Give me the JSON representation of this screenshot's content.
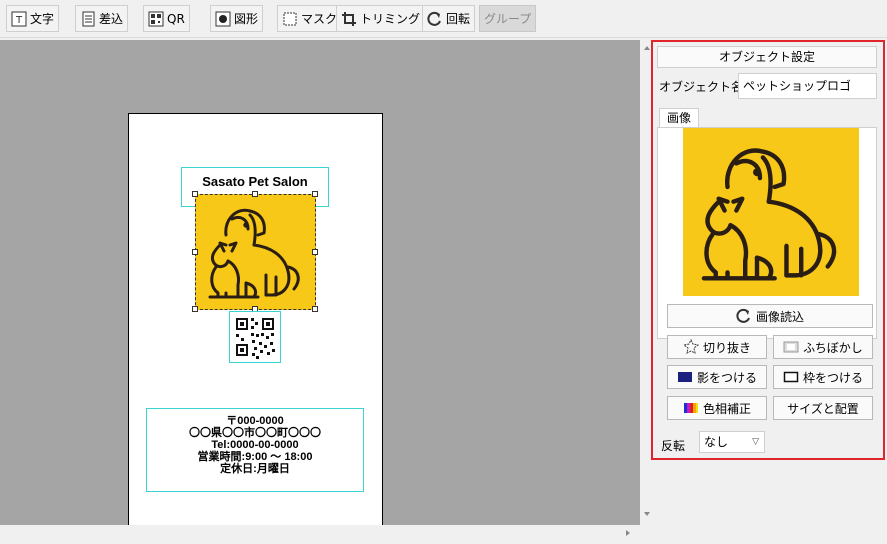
{
  "toolbar": {
    "text_label": "文字",
    "merge_label": "差込",
    "qr_label": "QR",
    "shape_label": "図形",
    "mask_label": "マスク",
    "trim_label": "トリミング",
    "rotate_label": "回転",
    "group_label": "グループ"
  },
  "canvas": {
    "title_text": "Sasato Pet Salon",
    "address_lines": [
      "〒000-0000",
      "〇〇県〇〇市〇〇町〇〇〇",
      "Tel:0000-00-0000",
      "営業時間:9:00 ～ 18:00",
      "定休日:月曜日"
    ]
  },
  "panel": {
    "header": "オブジェクト設定",
    "name_label": "オブジェクト名",
    "name_value": "ペットショップロゴ",
    "tab_image": "画像",
    "load_image_label": "画像読込",
    "cutout_label": "切り抜き",
    "blur_label": "ふちぼかし",
    "shadow_label": "影をつける",
    "frame_label": "枠をつける",
    "color_label": "色相補正",
    "size_label": "サイズと配置",
    "flip_label": "反転",
    "flip_value": "なし"
  },
  "colors": {
    "logo_bg": "#f7c818",
    "logo_line": "#2a1e14",
    "selection_border": "#3ad4d4",
    "panel_highlight": "#e0252e"
  }
}
